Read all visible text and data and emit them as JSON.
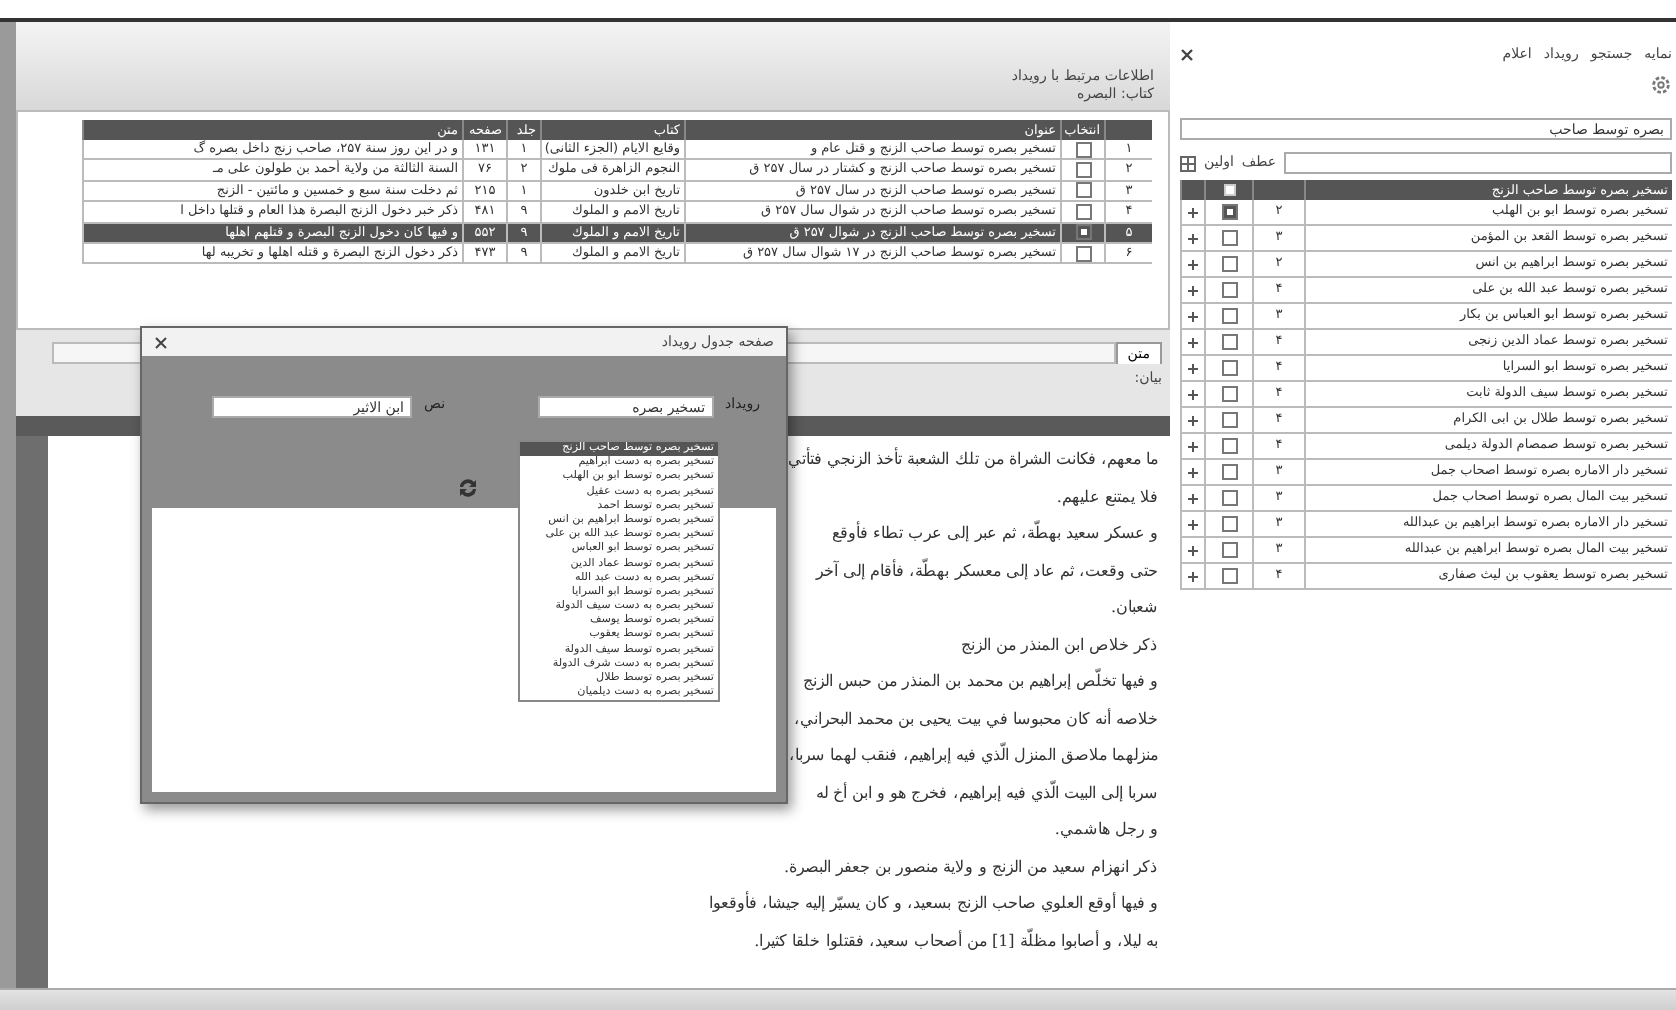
{
  "left_header": {
    "lines": [
      "اطلاعات مرتبط با رویداد",
      "کتاب: البصره"
    ]
  },
  "events_table": {
    "columns": [
      "",
      "انتخاب",
      "عنوان",
      "کتاب",
      "جلد",
      "صفحه",
      "متن"
    ],
    "rows": [
      {
        "index": "۱",
        "checked": false,
        "selected": false,
        "title": "تسخیر بصره توسط صاحب الزنج و قتل عام و",
        "book": "وقایع الایام (الجزء الثانی)",
        "volume": "۱",
        "page": "۱۳۱",
        "excerpt": "و در این روز سنة ۲۵۷، صاحب زنج داخل بصره گ"
      },
      {
        "index": "۲",
        "checked": false,
        "selected": false,
        "title": "تسخیر بصره توسط صاحب الزنج و کشتار در سال ۲۵۷ ق",
        "book": "النجوم الزاهرة فی ملوك",
        "volume": "۲",
        "page": "۷۶",
        "excerpt": "السنة الثالثة من ولاية أحمد بن طولون على مـ"
      },
      {
        "index": "۳",
        "checked": false,
        "selected": false,
        "title": "تسخیر بصره توسط صاحب الزنج در سال ۲۵۷ ق",
        "book": "تاریخ ابن خلدون",
        "volume": "۱",
        "page": "۲۱۵",
        "excerpt": "ثم دخلت سنة سبع و خمسين و مائتين - الزنج"
      },
      {
        "index": "۴",
        "checked": false,
        "selected": false,
        "title": "تسخیر بصره توسط صاحب الزنج در شوال سال ۲۵۷ ق",
        "book": "تاریخ الامم و الملوك",
        "volume": "۹",
        "page": "۴۸۱",
        "excerpt": "ذكر خبر دخول الزنج البصرة هذا العام و قتلها داخل ا"
      },
      {
        "index": "۵",
        "checked": true,
        "selected": true,
        "title": "تسخیر بصره توسط صاحب الزنج در شوال ۲۵۷ ق",
        "book": "تاریخ الامم و الملوك",
        "volume": "۹",
        "page": "۵۵۲",
        "excerpt": "و فيها كان دخول الزنج البصرة و قتلهم اهلها"
      },
      {
        "index": "۶",
        "checked": false,
        "selected": false,
        "title": "تسخیر بصره توسط صاحب الزنج در ۱۷ شوال سال ۲۵۷ ق",
        "book": "تاریخ الامم و الملوك",
        "volume": "۹",
        "page": "۴۷۳",
        "excerpt": "ذكر دخول الزنج البصرة و قتله اهلها و تخريبه لها"
      }
    ]
  },
  "text_tab": {
    "tabs": [
      {
        "label": "متن",
        "selected": true
      }
    ],
    "label": "بیان:"
  },
  "text_lines": [
    "ما معهم، فكانت الشراة من تلك الشعبة تأخذ الزنجي فتأتي",
    "فلا يمتنع عليهم.",
    "و عسكر سعيد بهطّة، ثم عبر إلى عرب تطاء فأوقع",
    "حتى وقعت، ثم عاد إلى معسكر بهطّة، فأقام إلى آخر",
    "شعبان.",
    "ذكر خلاص ابن المنذر من الزنج",
    "و فيها تخلّص إبراهيم بن محمد بن المنذر من حبس الزنج",
    "خلاصه أنه كان محبوسا في بيت يحيى بن محمد البحراني،",
    "منزلهما ملاصق المنزل الّذي فيه إبراهيم، فنقب لهما سربا،",
    "سربا إلى البيت الّذي فيه إبراهيم، فخرج هو و ابن أخ له",
    "و رجل هاشمي.",
    "ذكر انهزام سعيد من الزنج و ولاية منصور بن جعفر البصرة.",
    "و فيها أوقع العلوي صاحب الزنج بسعيد، و كان يسيّر إليه جيشا، فأوقعوا",
    "به ليلا، و أصابوا مظلّة [1] من أصحاب سعيد، فقتلوا خلقا كثيرا."
  ],
  "right_panel": {
    "menu": [
      "نمایه",
      "جستجو",
      "رویداد",
      "اعلام"
    ],
    "search": {
      "value": "بصره توسط صاحب"
    },
    "filter": {
      "labels": [
        "عطف",
        "اولین"
      ]
    },
    "table": {
      "header": "تسخیر بصره توسط صاحب الزنج",
      "rows": [
        {
          "title": "تسخیر بصره توسط ابو بن الهلب",
          "number": "۲",
          "checked": true
        },
        {
          "title": "تسخیر بصره توسط القعد بن المؤمن",
          "number": "۳",
          "checked": false
        },
        {
          "title": "تسخیر بصره توسط ابراهیم بن انس",
          "number": "۲",
          "checked": false
        },
        {
          "title": "تسخیر بصره توسط عبد الله بن علی",
          "number": "۴",
          "checked": false
        },
        {
          "title": "تسخیر بصره توسط ابو العباس بن بکار",
          "number": "۳",
          "checked": false
        },
        {
          "title": "تسخیر بصره توسط عماد الدین زنجی",
          "number": "۴",
          "checked": false
        },
        {
          "title": "تسخیر بصره توسط ابو السرایا",
          "number": "۴",
          "checked": false
        },
        {
          "title": "تسخیر بصره توسط سیف الدولة ثابت",
          "number": "۴",
          "checked": false
        },
        {
          "title": "تسخیر بصره توسط طلال بن ابی الکرام",
          "number": "۴",
          "checked": false
        },
        {
          "title": "تسخیر بصره توسط صمصام الدولة دیلمی",
          "number": "۴",
          "checked": false
        },
        {
          "title": "تسخیر دار الاماره بصره توسط اصحاب جمل",
          "number": "۳",
          "checked": false
        },
        {
          "title": "تسخیر بیت المال بصره توسط اصحاب جمل",
          "number": "۳",
          "checked": false
        },
        {
          "title": "تسخیر دار الاماره بصره توسط ابراهیم بن عبدالله",
          "number": "۳",
          "checked": false
        },
        {
          "title": "تسخیر بیت المال بصره توسط ابراهیم بن عبدالله",
          "number": "۳",
          "checked": false
        },
        {
          "title": "تسخیر بصره توسط یعقوب بن لیث صفاری",
          "number": "۴",
          "checked": false
        }
      ]
    }
  },
  "dialog": {
    "title": "صفحه جدول رویداد",
    "field_label": "نص",
    "field_value": "ابن الاثیر",
    "combo_label": "رویداد",
    "combo_value": "تسخیر بصره",
    "options": [
      {
        "label": "تسخیر بصره توسط صاحب الزنج",
        "selected": true
      },
      {
        "label": "تسخیر بصره به دست ابراهیم",
        "selected": false
      },
      {
        "label": "تسخیر بصره توسط ابو بن الهلب",
        "selected": false
      },
      {
        "label": "تسخیر بصره به دست عقیل",
        "selected": false
      },
      {
        "label": "تسخیر بصره توسط احمد",
        "selected": false
      },
      {
        "label": "تسخیر بصره توسط ابراهیم بن انس",
        "selected": false
      },
      {
        "label": "تسخیر بصره توسط عبد الله بن علی",
        "selected": false
      },
      {
        "label": "تسخیر بصره توسط ابو العباس",
        "selected": false
      },
      {
        "label": "تسخیر بصره توسط عماد الدین",
        "selected": false
      },
      {
        "label": "تسخیر بصره به دست عبد الله",
        "selected": false
      },
      {
        "label": "تسخیر بصره توسط ابو السرایا",
        "selected": false
      },
      {
        "label": "تسخیر بصره به دست سیف الدولة",
        "selected": false
      },
      {
        "label": "تسخیر بصره توسط یوسف",
        "selected": false
      },
      {
        "label": "تسخیر بصره توسط یعقوب",
        "selected": false
      },
      {
        "label": "تسخیر بصره توسط سیف الدولة",
        "selected": false
      },
      {
        "label": "تسخیر بصره به دست شرف الدولة",
        "selected": false
      },
      {
        "label": "تسخیر بصره توسط طلال",
        "selected": false
      },
      {
        "label": "تسخیر بصره به دست دیلمیان",
        "selected": false
      }
    ]
  }
}
